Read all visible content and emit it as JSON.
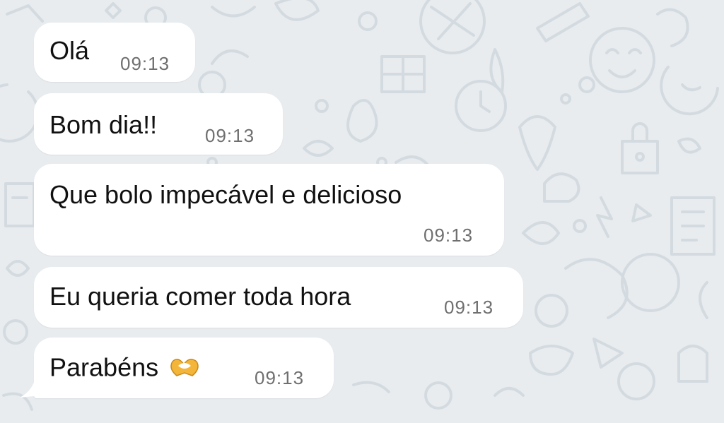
{
  "chat": {
    "messages": [
      {
        "text": "Olá",
        "time": "09:13"
      },
      {
        "text": "Bom dia!!",
        "time": "09:13"
      },
      {
        "text": "Que bolo impecável e delicioso",
        "time": "09:13"
      },
      {
        "text": "Eu queria comer toda hora",
        "time": "09:13"
      },
      {
        "text": "Parabéns",
        "time": "09:13",
        "emoji": "heart-hands"
      }
    ]
  },
  "colors": {
    "wallpaper": "#e8ecef",
    "doodle": "#d3dbe1",
    "bubble": "#ffffff",
    "text": "#111111",
    "timestamp": "#6f6f6f",
    "emoji": "#f4b63a"
  }
}
